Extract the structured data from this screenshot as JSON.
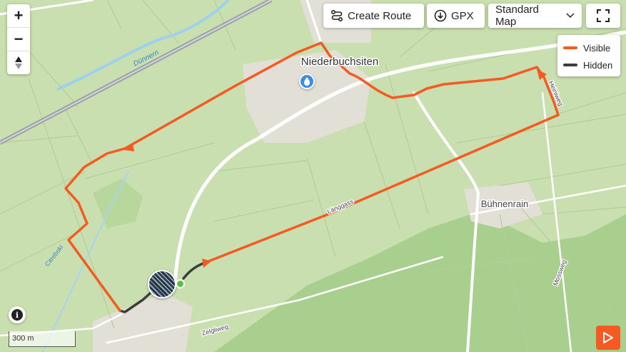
{
  "map": {
    "labels": {
      "town": "Niederbuchsiten",
      "hamlet": "Bühnenrain",
      "river": "Dünnern",
      "road_langgass": "Länggass",
      "road_heiniweg": "Heiniweg",
      "road_mossweg": "Mossweg",
      "road_zelgliweg": "Zelgliweg",
      "road_citrebski": "Citrebski"
    },
    "colors": {
      "background": "#c9dfaf",
      "forest": "#a8cf8d",
      "village": "#e2e0d6",
      "road": "#ffffff",
      "route_visible": "#f45a22",
      "route_hidden": "#3d3d3d",
      "rail": "#9aa0a6"
    }
  },
  "controls": {
    "zoom_in": "+",
    "zoom_out": "−",
    "compass": "compass-icon"
  },
  "toolbar": {
    "create_route": "Create Route",
    "gpx": "GPX",
    "map_style": "Standard Map",
    "fullscreen": "fullscreen-icon"
  },
  "legend": {
    "visible_label": "Visible",
    "hidden_label": "Hidden"
  },
  "footer": {
    "scale_label": "300 m",
    "info": "i"
  }
}
